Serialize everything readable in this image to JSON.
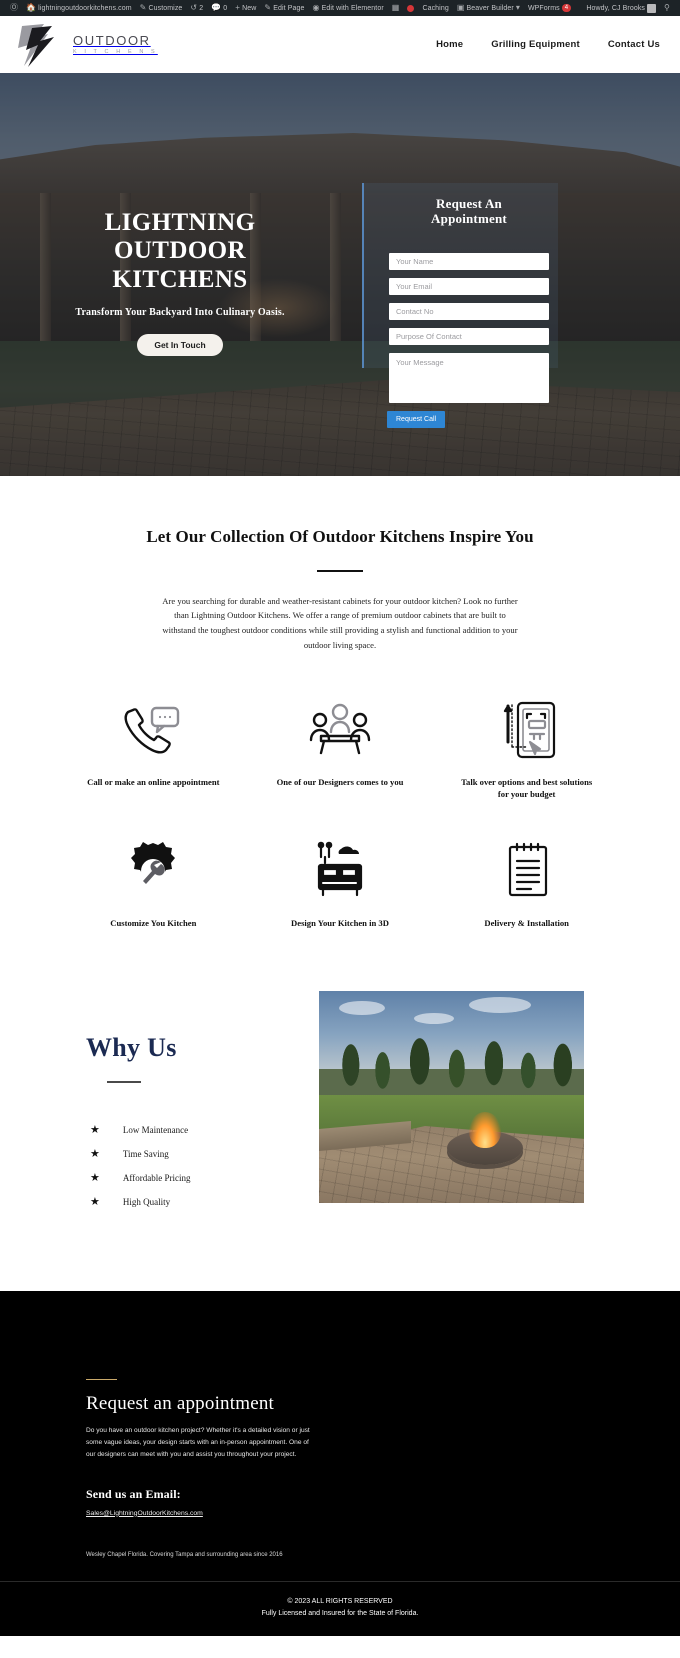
{
  "adminbar": {
    "wp_logo_icon": "wordpress-icon",
    "items": [
      {
        "icon": "home-icon",
        "label": "lightningoutdoorkitchens.com"
      },
      {
        "icon": "pencil-icon",
        "label": "Customize"
      },
      {
        "icon": "refresh-icon",
        "label": "2"
      },
      {
        "icon": "comment-icon",
        "label": "0"
      },
      {
        "icon": "plus-icon",
        "label": "New"
      },
      {
        "icon": "edit-icon",
        "label": "Edit Page"
      },
      {
        "icon": "elementor-icon",
        "label": "Edit with Elementor"
      },
      {
        "icon": "sitemap-icon",
        "label": ""
      },
      {
        "icon": "alert-dot-icon",
        "label": ""
      },
      {
        "icon": "caching-icon",
        "label": "Caching"
      },
      {
        "icon": "builder-icon",
        "label": "Beaver Builder"
      },
      {
        "icon": "wpforms-icon",
        "label": "WPForms"
      }
    ],
    "wpforms_badge": "4",
    "howdy": "Howdy, CJ Brooks",
    "avatar_icon": "user-avatar-icon",
    "search_icon": "search-icon"
  },
  "header": {
    "logo_icon": "lightning-bolt-logo-icon",
    "logo_top": "OUTDOOR",
    "logo_sub": "K I T C H E N S",
    "nav": [
      {
        "label": "Home"
      },
      {
        "label": "Grilling Equipment"
      },
      {
        "label": "Contact Us"
      }
    ]
  },
  "hero": {
    "title_lines": [
      "LIGHTNING",
      "OUTDOOR",
      "KITCHENS"
    ],
    "subtitle": "Transform Your Backyard Into Culinary Oasis.",
    "cta_label": "Get In Touch",
    "form": {
      "title_lines": [
        "Request An",
        "Appointment"
      ],
      "fields": [
        {
          "name": "your-name",
          "placeholder": "Your Name",
          "value": ""
        },
        {
          "name": "your-email",
          "placeholder": "Your Email",
          "value": ""
        },
        {
          "name": "contact-no",
          "placeholder": "Contact No",
          "value": ""
        },
        {
          "name": "purpose-of-contact",
          "placeholder": "Purpose Of Contact",
          "value": ""
        }
      ],
      "message_placeholder": "Your Message",
      "message_value": "",
      "submit_label": "Request Call",
      "submit_color": "#2e86d4"
    }
  },
  "collection": {
    "title": "Let Our Collection Of Outdoor Kitchens Inspire You",
    "paragraph": "Are you searching for durable and weather-resistant cabinets for your outdoor kitchen? Look no further than Lightning Outdoor Kitchens. We offer a range of premium outdoor cabinets that are built to withstand the toughest outdoor conditions while still providing a stylish and functional addition to your outdoor living space."
  },
  "features": [
    {
      "icon": "phone-chat-icon",
      "label": "Call or make an online appointment"
    },
    {
      "icon": "meeting-table-icon",
      "label": "One of our Designers comes to you"
    },
    {
      "icon": "tablet-design-icon",
      "label": "Talk over options and best solutions for your budget"
    },
    {
      "icon": "gear-wrench-icon",
      "label": "Customize You Kitchen"
    },
    {
      "icon": "grill-3d-icon",
      "label": "Design Your Kitchen in 3D"
    },
    {
      "icon": "clipboard-list-icon",
      "label": "Delivery & Installation"
    }
  ],
  "whyus": {
    "title": "Why Us",
    "title_color": "#1b2a52",
    "bullet_icon": "star-icon",
    "items": [
      {
        "label": "Low Maintenance"
      },
      {
        "label": "Time Saving"
      },
      {
        "label": "Affordable Pricing"
      },
      {
        "label": "High Quality"
      }
    ],
    "image_alt": "outdoor-fire-pit-patio-photo"
  },
  "footer": {
    "accent_color": "#c9a96a",
    "title": "Request an appointment",
    "body": "Do you have an outdoor kitchen project? Whether it's a detailed vision or just some vague ideas, your design starts with an in-person appointment. One of our designers can meet with you and assist you throughout your project.",
    "email_heading": "Send us an Email:",
    "email": "Sales@LightningOutdoorKitchens.com",
    "note": "Wesley Chapel Florida. Covering Tampa and surrounding area since 2016"
  },
  "copyright": {
    "line1": "© 2023 ALL RIGHTS RESERVED",
    "line2": "Fully Licensed and Insured for the State of Florida."
  }
}
